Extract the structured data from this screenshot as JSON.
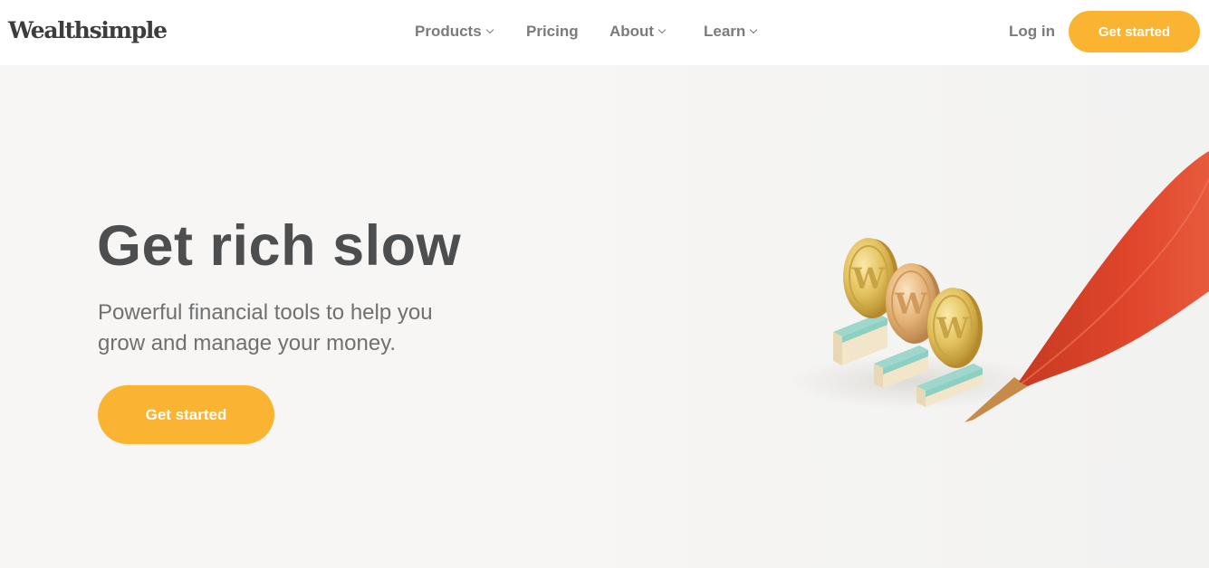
{
  "header": {
    "logo": "Wealthsimple",
    "nav": [
      {
        "label": "Products",
        "has_dropdown": true
      },
      {
        "label": "Pricing",
        "has_dropdown": false
      },
      {
        "label": "About",
        "has_dropdown": true
      },
      {
        "label": "Learn",
        "has_dropdown": true
      }
    ],
    "login_label": "Log in",
    "cta_label": "Get started"
  },
  "hero": {
    "title": "Get rich slow",
    "subtitle": "Powerful financial tools to help you grow and manage your money.",
    "cta_label": "Get started"
  },
  "colors": {
    "accent": "#fab432",
    "ribbon": "#e0462b",
    "coin": "#e2c15c",
    "base": "#8ccfc3",
    "background": "#f7f6f4",
    "text": "#4d4e50"
  },
  "icons": [
    "chevron-down-icon"
  ]
}
